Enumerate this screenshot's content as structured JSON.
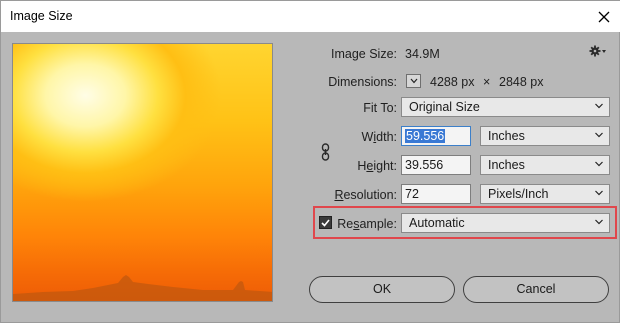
{
  "window": {
    "title": "Image Size"
  },
  "info": {
    "image_size_label": "Image Size:",
    "image_size_value": "34.9M",
    "dimensions_label": "Dimensions:",
    "dim_width": "4288 px",
    "dim_sep": "×",
    "dim_height": "2848 px"
  },
  "fit_to": {
    "label": "Fit To:",
    "value": "Original Size"
  },
  "width": {
    "label_pre": "W",
    "label_mn": "i",
    "label_post": "dth:",
    "value": "59.556",
    "unit": "Inches"
  },
  "height": {
    "label_pre": "H",
    "label_mn": "e",
    "label_post": "ight:",
    "value": "39.556",
    "unit": "Inches"
  },
  "resolution": {
    "label_pre": "",
    "label_mn": "R",
    "label_post": "esolution:",
    "value": "72",
    "unit": "Pixels/Inch"
  },
  "resample": {
    "checked": true,
    "label_pre": "Re",
    "label_mn": "s",
    "label_post": "ample:",
    "value": "Automatic",
    "highlight_color": "#e0474c"
  },
  "buttons": {
    "ok": "OK",
    "cancel": "Cancel"
  },
  "icons": {
    "close": "close-icon",
    "gear": "gear-icon",
    "chain": "link-chain-icon",
    "chevron": "chevron-down-icon"
  }
}
